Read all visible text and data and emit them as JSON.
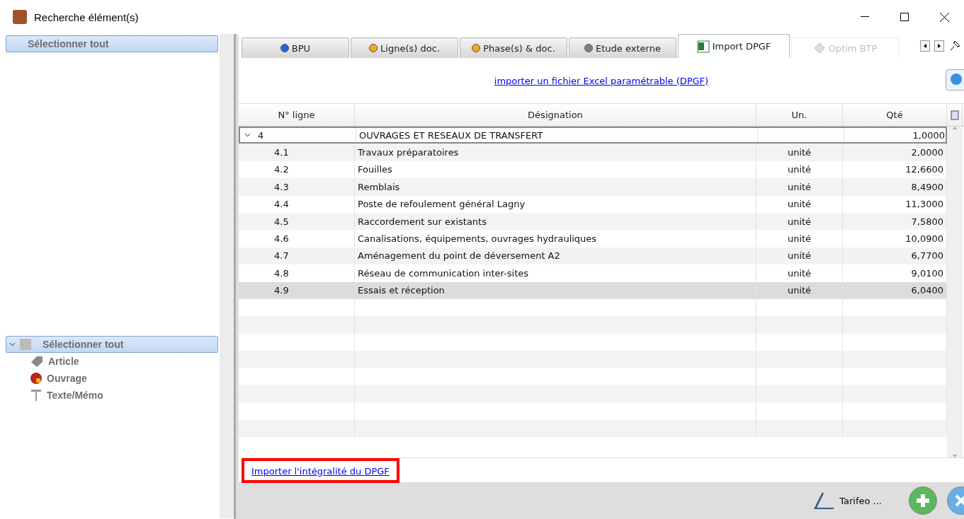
{
  "window": {
    "title": "Recherche élément(s)"
  },
  "left_list": {
    "items": [
      {
        "label": "Sélectionner tout",
        "selected": true
      }
    ]
  },
  "left_tree": {
    "root": {
      "label": "Sélectionner tout",
      "selected": true,
      "expanded": true,
      "children": [
        {
          "label": "Article",
          "kind": "tag"
        },
        {
          "label": "Ouvrage",
          "kind": "ball"
        },
        {
          "label": "Texte/Mémo",
          "kind": "text"
        }
      ]
    }
  },
  "tabs": [
    {
      "label": "BPU",
      "kind": "dot",
      "color": "#2563d8",
      "selected": false,
      "disabled": false
    },
    {
      "label": "Ligne(s) doc.",
      "kind": "dot",
      "color": "#f5a623",
      "selected": false,
      "disabled": false
    },
    {
      "label": "Phase(s) & doc.",
      "kind": "dot",
      "color": "#f5a623",
      "selected": false,
      "disabled": false
    },
    {
      "label": "Etude externe",
      "kind": "dot",
      "color": "#808080",
      "selected": false,
      "disabled": false
    },
    {
      "label": "Import DPGF",
      "kind": "excel",
      "selected": true,
      "disabled": false
    },
    {
      "label": "Optim BTP",
      "kind": "diamond",
      "selected": false,
      "disabled": true
    }
  ],
  "import_link": "importer un fichier Excel paramétrable (DPGF)",
  "table": {
    "columns": [
      "N° ligne",
      "Désignation",
      "Un.",
      "Qté"
    ],
    "rows": [
      {
        "num": "4",
        "designation": "OUVRAGES ET RESEAUX DE TRANSFERT",
        "unit": "",
        "qty": "1,0000",
        "selected": false,
        "expanded": true,
        "children": [
          {
            "num": "4.1",
            "designation": "Travaux préparatoires",
            "unit": "unité",
            "qty": "2,0000",
            "selected": false
          },
          {
            "num": "4.2",
            "designation": "Fouilles",
            "unit": "unité",
            "qty": "12,6600",
            "selected": false
          },
          {
            "num": "4.3",
            "designation": "Remblais",
            "unit": "unité",
            "qty": "8,4900",
            "selected": false
          },
          {
            "num": "4.4",
            "designation": "Poste de refoulement général Lagny",
            "unit": "unité",
            "qty": "11,3000",
            "selected": false
          },
          {
            "num": "4.5",
            "designation": "Raccordement sur existants",
            "unit": "unité",
            "qty": "7,5800",
            "selected": false
          },
          {
            "num": "4.6",
            "designation": "Canalisations, équipements, ouvrages hydrauliques",
            "unit": "unité",
            "qty": "10,0900",
            "selected": false
          },
          {
            "num": "4.7",
            "designation": "Aménagement du point de déversement A2",
            "unit": "unité",
            "qty": "6,7700",
            "selected": false
          },
          {
            "num": "4.8",
            "designation": "Réseau de communication inter-sites",
            "unit": "unité",
            "qty": "9,0100",
            "selected": false
          },
          {
            "num": "4.9",
            "designation": "Essais et réception",
            "unit": "unité",
            "qty": "6,0400",
            "selected": true
          }
        ]
      }
    ]
  },
  "import_all_link": "Importer l'intégralité du DPGF",
  "footer": {
    "tarifeo_label": "Tarifeo ..."
  }
}
